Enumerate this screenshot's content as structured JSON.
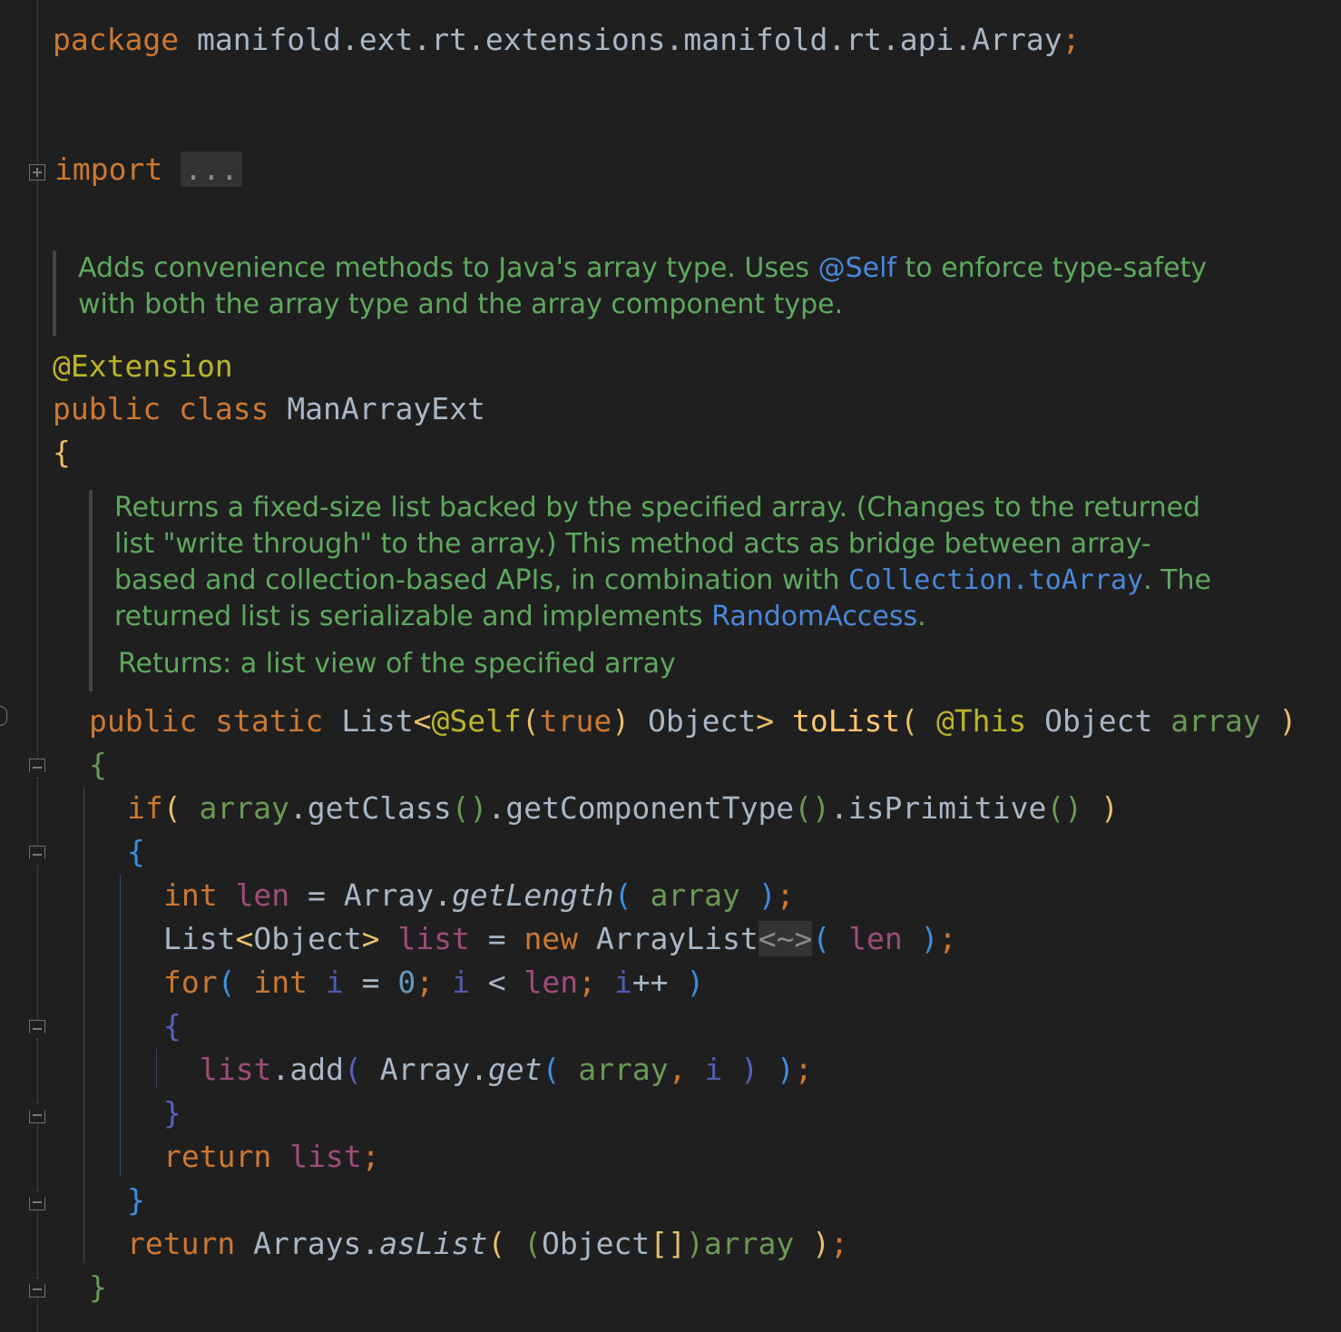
{
  "editor": {
    "language": "java",
    "theme": "dark",
    "fold_placeholder": "...",
    "diamond_placeholder": "<~>"
  },
  "code": {
    "package_kw": "package",
    "package_name": "manifold.ext.rt.extensions.manifold.rt.api.Array",
    "import_kw": "import",
    "class_doc": {
      "before_ref": "Adds convenience methods to Java's array type. Uses ",
      "ref": "@Self",
      "after_ref_line1": " to enforce type-safety",
      "line2": "with both the array type and the array component type."
    },
    "annotation": "@Extension",
    "kw_public": "public",
    "kw_class": "class",
    "class_name": "ManArrayExt",
    "method_doc": {
      "line1": "Returns a fixed-size list backed by the specified array. (Changes to the returned",
      "line2": "list \"write through\" to the array.) This method acts as bridge between array-",
      "line3_a": "based and collection-based APIs, in combination with ",
      "line3_ref": "Collection.toArray",
      "line3_b": ". The",
      "line4_a": "returned list is serializable and implements ",
      "line4_ref": "RandomAccess",
      "line4_b": ".",
      "returns": "Returns: a list view of the specified array"
    },
    "kw_static": "static",
    "type_list": "List",
    "ann_self": "@Self",
    "kw_true": "true",
    "type_object": "Object",
    "method_name": "toList",
    "ann_this": "@This",
    "param_array": "array",
    "kw_if": "if",
    "call_getclass": "getClass",
    "call_getcomponenttype": "getComponentType",
    "call_isprimitive": "isPrimitive",
    "kw_int": "int",
    "var_len": "len",
    "type_array": "Array",
    "call_getlength": "getLength",
    "var_list": "list",
    "kw_new": "new",
    "type_arraylist": "ArrayList",
    "kw_for": "for",
    "var_i": "i",
    "num_zero": "0",
    "call_add": "add",
    "call_get": "get",
    "kw_return": "return",
    "type_arrays": "Arrays",
    "call_aslist": "asList"
  }
}
